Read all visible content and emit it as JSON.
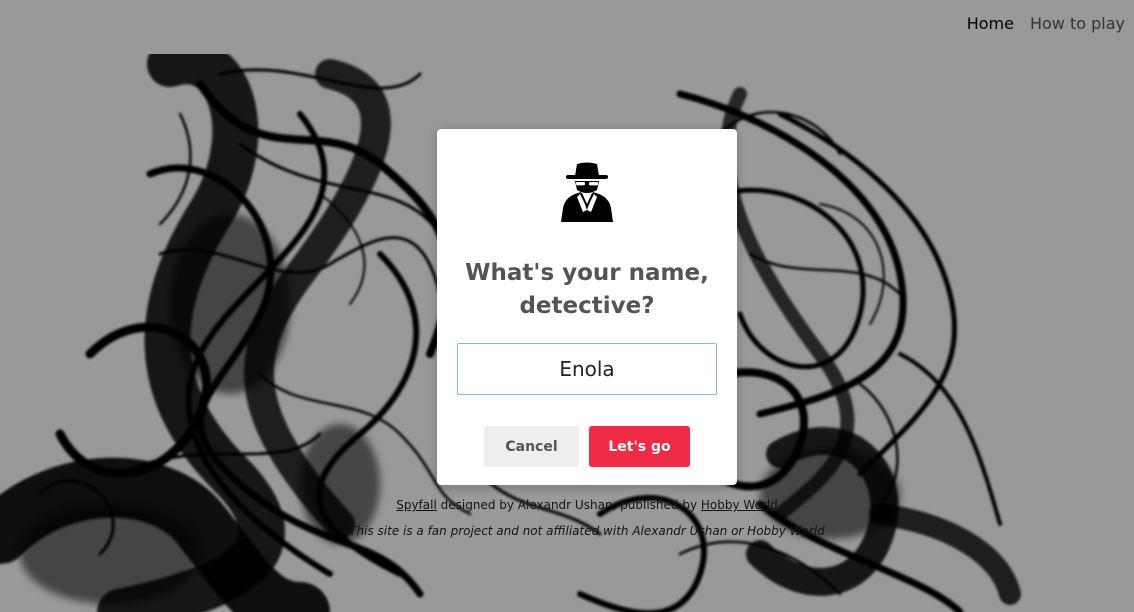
{
  "nav": {
    "home": "Home",
    "how_to_play": "How to play"
  },
  "footer": {
    "spyfall_link": "Spyfall",
    "designed_by": " designed by Alexandr Ushan, published by ",
    "hobby_world_link": "Hobby World",
    "disclaimer": "This site is a fan project and not affiliated with Alexandr Ushan or Hobby World"
  },
  "modal": {
    "icon": "spy-icon",
    "title": "What's your name, detective?",
    "name_value": "Enola",
    "cancel_label": "Cancel",
    "go_label": "Let's go"
  },
  "colors": {
    "overlay": "rgba(0,0,0,0.40)",
    "primary_button": "#ee2a45",
    "secondary_button": "#eeeeee",
    "input_border": "#7fb8e0",
    "title_text": "#545454"
  }
}
